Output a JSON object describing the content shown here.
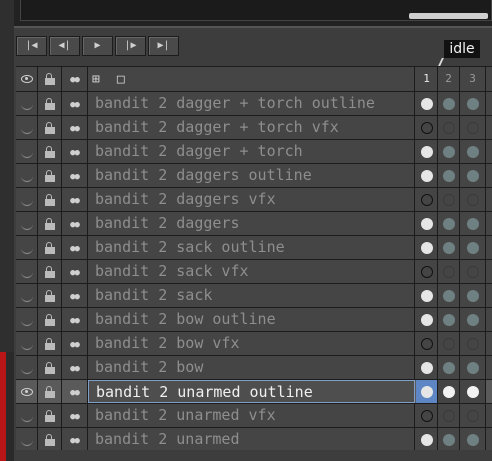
{
  "toolbar": {
    "buttons": [
      {
        "name": "first-frame",
        "glyph": "|◀"
      },
      {
        "name": "prev-frame",
        "glyph": "◀|"
      },
      {
        "name": "play",
        "glyph": "▶"
      },
      {
        "name": "next-frame",
        "glyph": "|▶"
      },
      {
        "name": "last-frame",
        "glyph": "▶|"
      }
    ]
  },
  "tag": {
    "label": "idle"
  },
  "header": {
    "frames": [
      "1",
      "2",
      "3"
    ],
    "icons": [
      "eye-icon",
      "lock-icon",
      "link-icon",
      "layer-tree-icon",
      "new-layer-icon"
    ]
  },
  "layers": [
    {
      "name": "bandit 2 dagger + torch outline",
      "cels": [
        "full",
        "grey",
        "grey"
      ],
      "visible": false,
      "selected": false
    },
    {
      "name": "bandit 2 dagger + torch vfx",
      "cels": [
        "empty",
        "ghost",
        "ghost"
      ],
      "visible": false,
      "selected": false
    },
    {
      "name": "bandit 2 dagger + torch",
      "cels": [
        "full",
        "grey",
        "grey"
      ],
      "visible": false,
      "selected": false
    },
    {
      "name": "bandit 2 daggers outline",
      "cels": [
        "full",
        "grey",
        "grey"
      ],
      "visible": false,
      "selected": false
    },
    {
      "name": "bandit 2 daggers vfx",
      "cels": [
        "empty",
        "ghost",
        "ghost"
      ],
      "visible": false,
      "selected": false
    },
    {
      "name": "bandit 2 daggers",
      "cels": [
        "full",
        "grey",
        "grey"
      ],
      "visible": false,
      "selected": false
    },
    {
      "name": "bandit 2 sack outline",
      "cels": [
        "full",
        "grey",
        "grey"
      ],
      "visible": false,
      "selected": false
    },
    {
      "name": "bandit 2 sack vfx",
      "cels": [
        "empty",
        "ghost",
        "ghost"
      ],
      "visible": false,
      "selected": false
    },
    {
      "name": "bandit 2 sack",
      "cels": [
        "full",
        "grey",
        "grey"
      ],
      "visible": false,
      "selected": false
    },
    {
      "name": "bandit 2 bow outline",
      "cels": [
        "full",
        "grey",
        "grey"
      ],
      "visible": false,
      "selected": false
    },
    {
      "name": "bandit 2 bow vfx",
      "cels": [
        "empty",
        "ghost",
        "ghost"
      ],
      "visible": false,
      "selected": false
    },
    {
      "name": "bandit 2 bow",
      "cels": [
        "full",
        "grey",
        "grey"
      ],
      "visible": false,
      "selected": false
    },
    {
      "name": "bandit 2 unarmed outline",
      "cels": [
        "full",
        "white",
        "white"
      ],
      "visible": true,
      "selected": true
    },
    {
      "name": "bandit 2 unarmed vfx",
      "cels": [
        "empty",
        "ghost",
        "ghost"
      ],
      "visible": false,
      "selected": false
    },
    {
      "name": "bandit 2 unarmed",
      "cels": [
        "full",
        "grey",
        "grey"
      ],
      "visible": false,
      "selected": false
    }
  ],
  "colors": {
    "selection_frame": "#5f86c4",
    "accent_red": "#b81616"
  }
}
